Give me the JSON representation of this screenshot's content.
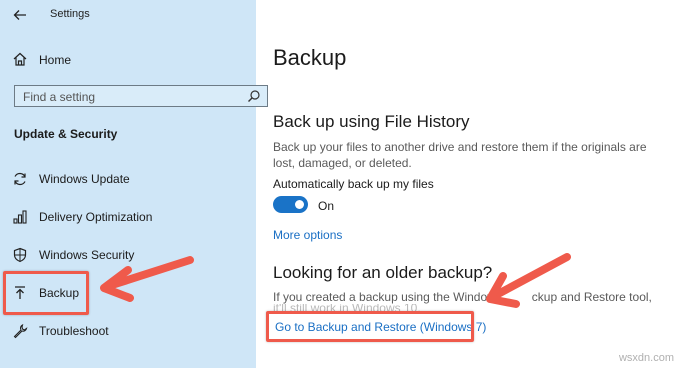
{
  "app": {
    "title": "Settings"
  },
  "sidebar": {
    "home_label": "Home",
    "search_placeholder": "Find a setting",
    "section_title": "Update & Security",
    "items": [
      {
        "label": "Windows Update",
        "icon": "refresh-icon"
      },
      {
        "label": "Delivery Optimization",
        "icon": "delivery-optimization-icon"
      },
      {
        "label": "Windows Security",
        "icon": "shield-icon"
      },
      {
        "label": "Backup",
        "icon": "backup-upload-icon"
      },
      {
        "label": "Troubleshoot",
        "icon": "wrench-icon"
      }
    ]
  },
  "main": {
    "page_title": "Backup",
    "file_history": {
      "heading": "Back up using File History",
      "description": "Back up your files to another drive and restore them if the originals are lost, damaged, or deleted.",
      "toggle_label": "Automatically back up my files",
      "toggle_state": "On",
      "toggle_on": true,
      "more_options_link": "More options"
    },
    "older_backup": {
      "heading": "Looking for an older backup?",
      "description_visible_start": "If you created a backup using the Windows",
      "description_visible_end": "ckup and Restore tool,",
      "description_line2": "it'll still work in Windows 10.",
      "link": "Go to Backup and Restore (Windows 7)"
    }
  },
  "annotations": {
    "highlight_color": "#ef5a4b"
  },
  "colors": {
    "sidebar_bg": "#cfe6f7",
    "accent": "#1a73c7",
    "link": "#1a6fc4"
  },
  "watermark": "wsxdn.com"
}
